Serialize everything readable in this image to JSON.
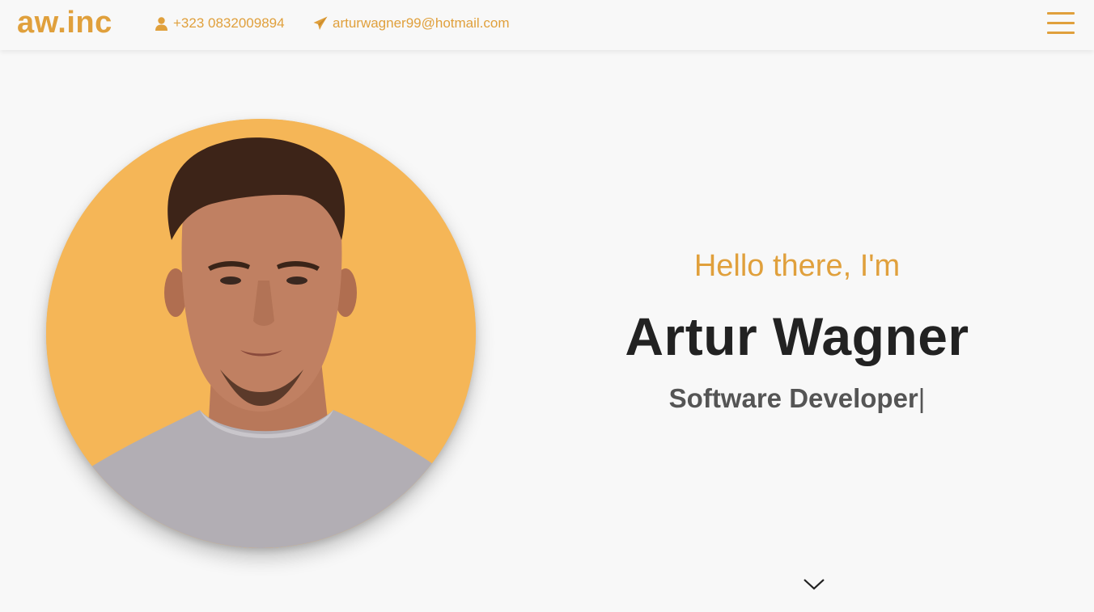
{
  "brand": {
    "name": "aw.inc"
  },
  "contacts": {
    "phone": {
      "icon": "user-icon",
      "text": "+323 0832009894"
    },
    "email": {
      "icon": "paper-plane-icon",
      "text": "arturwagner99@hotmail.com"
    }
  },
  "menu": {
    "icon": "hamburger-menu-icon"
  },
  "hero": {
    "greeting": "Hello there, I'm",
    "name": "Artur Wagner",
    "role": "Software Developer",
    "caret": "|",
    "scroll_icon": "chevron-down-icon"
  },
  "colors": {
    "accent": "#e0a03c",
    "portrait_bg": "#f5b657",
    "heading": "#222222",
    "subheading": "#555555",
    "background": "#f8f8f8"
  }
}
